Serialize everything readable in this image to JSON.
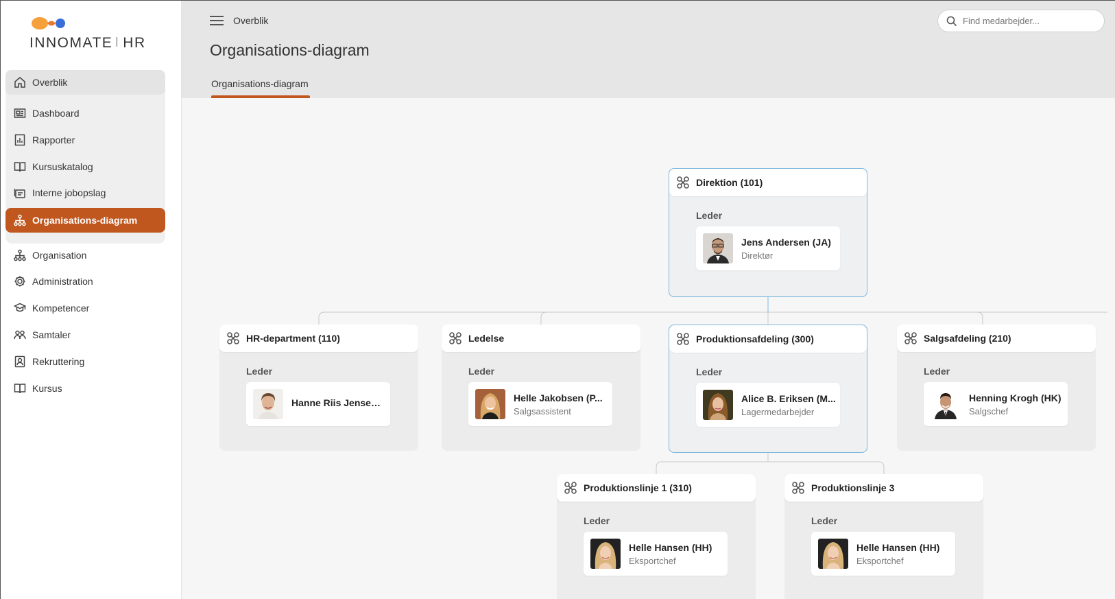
{
  "brand": {
    "name_left": "INNOMATE",
    "name_right": "HR",
    "orange": "#f5a03a",
    "blue": "#3a6fd8"
  },
  "accent": "#c0571f",
  "sidebar": {
    "items": [
      {
        "label": "Overblik",
        "icon": "home-icon"
      },
      {
        "label": "Dashboard",
        "icon": "dashboard-icon"
      },
      {
        "label": "Rapporter",
        "icon": "report-icon"
      },
      {
        "label": "Kursuskatalog",
        "icon": "book-open-icon"
      },
      {
        "label": "Interne jobopslag",
        "icon": "job-post-icon"
      },
      {
        "label": "Organisations-diagram",
        "icon": "org-chart-icon"
      },
      {
        "label": "Organisation",
        "icon": "org-chart-icon"
      },
      {
        "label": "Administration",
        "icon": "gear-icon"
      },
      {
        "label": "Kompetencer",
        "icon": "graduation-cap-icon"
      },
      {
        "label": "Samtaler",
        "icon": "people-icon"
      },
      {
        "label": "Rekruttering",
        "icon": "recruit-icon"
      },
      {
        "label": "Kursus",
        "icon": "book-icon"
      }
    ]
  },
  "header": {
    "breadcrumb": "Overblik",
    "title": "Organisations-diagram",
    "tab": "Organisations-diagram",
    "search_placeholder": "Find medarbejder..."
  },
  "org": {
    "leader_label": "Leder",
    "units": [
      {
        "name": "Direktion (101)",
        "leader": "Jens Andersen (JA)",
        "title": "Direktør"
      },
      {
        "name": "HR-department (110)",
        "leader": "Hanne Riis Jensen ...",
        "title": ""
      },
      {
        "name": "Ledelse",
        "leader": "Helle Jakobsen (P...",
        "title": "Salgsassistent"
      },
      {
        "name": "Produktionsafdeling (300)",
        "leader": "Alice B. Eriksen (M...",
        "title": "Lagermedarbejder"
      },
      {
        "name": "Salgsafdeling (210)",
        "leader": "Henning Krogh (HK)",
        "title": "Salgschef"
      },
      {
        "name": "Produktionslinje 1 (310)",
        "leader": "Helle Hansen (HH)",
        "title": "Eksportchef"
      },
      {
        "name": "Produktionslinje 3",
        "leader": "Helle Hansen (HH)",
        "title": "Eksportchef"
      }
    ]
  }
}
